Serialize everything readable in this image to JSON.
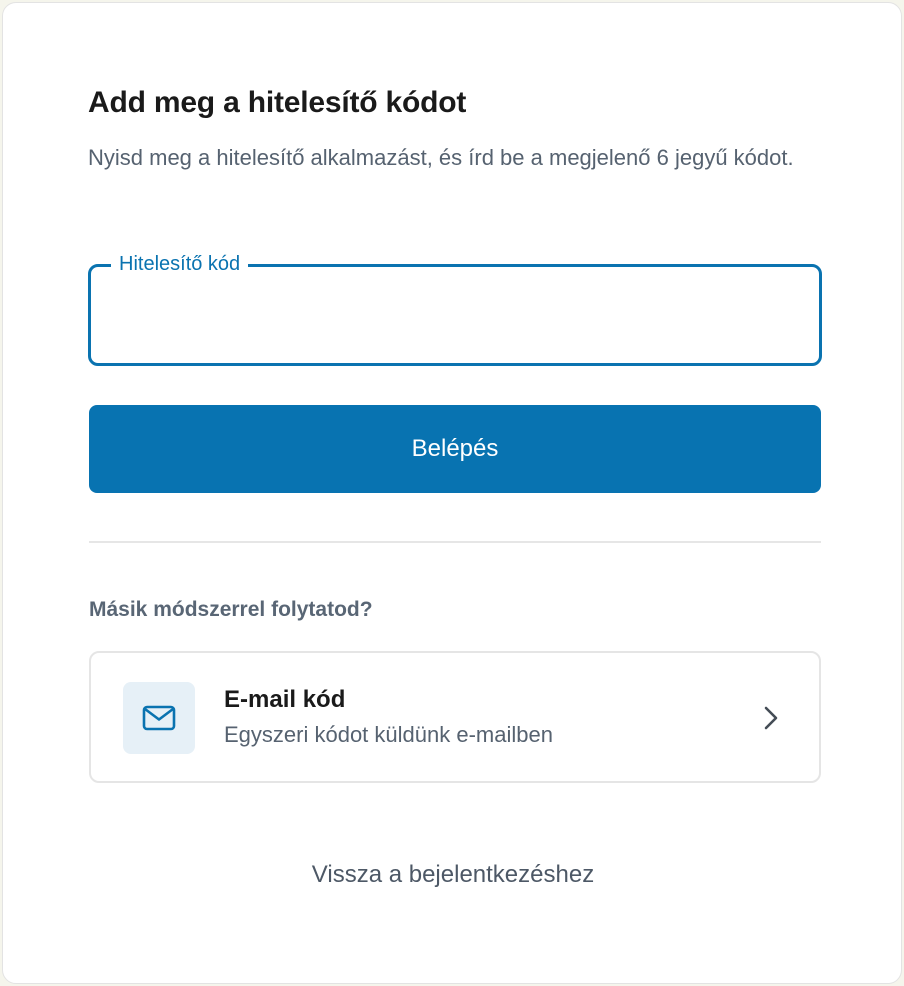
{
  "form": {
    "title": "Add meg a hitelesítő kódot",
    "subtitle": "Nyisd meg a hitelesítő alkalmazást, és írd be a megjelenő 6 jegyű kódot.",
    "code_field": {
      "label": "Hitelesítő kód",
      "value": "",
      "placeholder": ""
    },
    "submit_label": "Belépés"
  },
  "alternatives": {
    "heading": "Másik módszerrel folytatod?",
    "methods": [
      {
        "title": "E-mail kód",
        "description": "Egyszeri kódot küldünk e-mailben",
        "icon": "mail-icon"
      }
    ]
  },
  "back_link": "Vissza a bejelentkezéshez",
  "colors": {
    "primary": "#0873b1",
    "icon_background": "#e6f0f7",
    "text_muted": "#566270"
  }
}
